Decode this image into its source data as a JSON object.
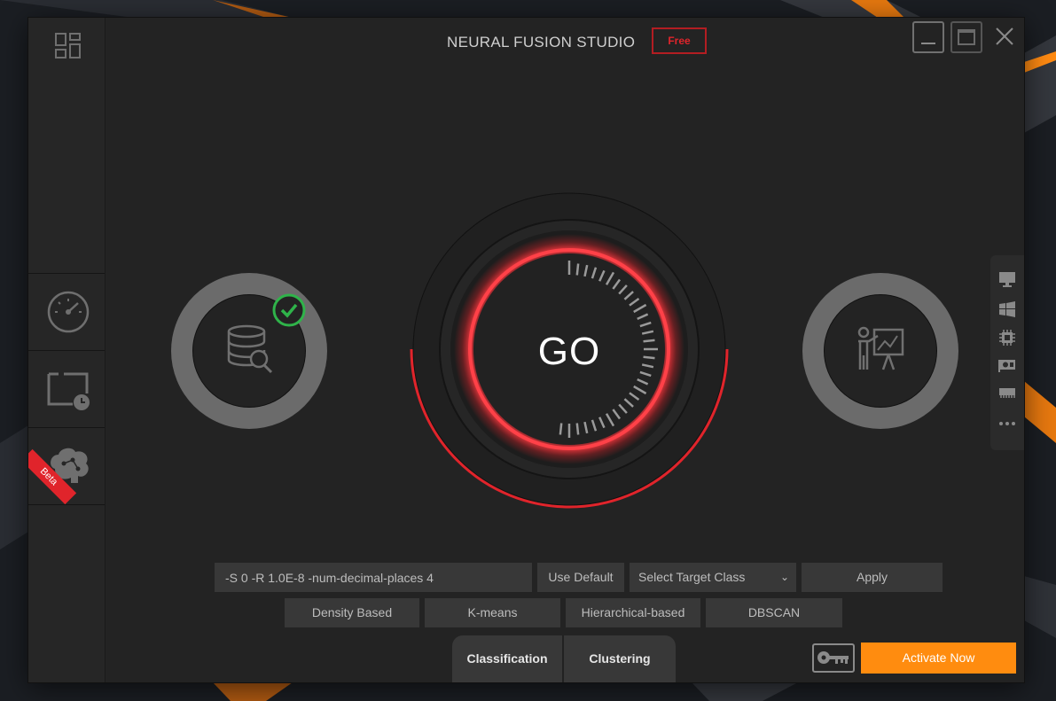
{
  "app": {
    "title": "NEURAL FUSION STUDIO",
    "edition_badge": "Free"
  },
  "sidebar": {
    "items": [
      {
        "icon": "dashboard-icon"
      },
      {
        "icon": "speedometer-icon"
      },
      {
        "icon": "scheduled-folder-icon"
      },
      {
        "icon": "brain-icon",
        "ribbon": "Beta"
      }
    ]
  },
  "main": {
    "go_label": "GO",
    "input_status": "checked"
  },
  "right_toolbar": {
    "icons": [
      "monitor-icon",
      "windows-icon",
      "cpu-chip-icon",
      "graphics-card-icon",
      "memory-icon",
      "more-icon"
    ]
  },
  "controls": {
    "params_value": "-S 0 -R 1.0E-8 -num-decimal-places 4",
    "use_default": "Use Default",
    "select_target": "Select Target Class",
    "apply": "Apply",
    "algorithms": [
      "Density Based",
      "K-means",
      "Hierarchical-based",
      "DBSCAN"
    ]
  },
  "tabs": {
    "classification": "Classification",
    "clustering": "Clustering"
  },
  "footer": {
    "activate": "Activate Now"
  },
  "colors": {
    "accent_red": "#e0242b",
    "activate_orange": "#ff8c0f",
    "success_green": "#2fb34a"
  }
}
